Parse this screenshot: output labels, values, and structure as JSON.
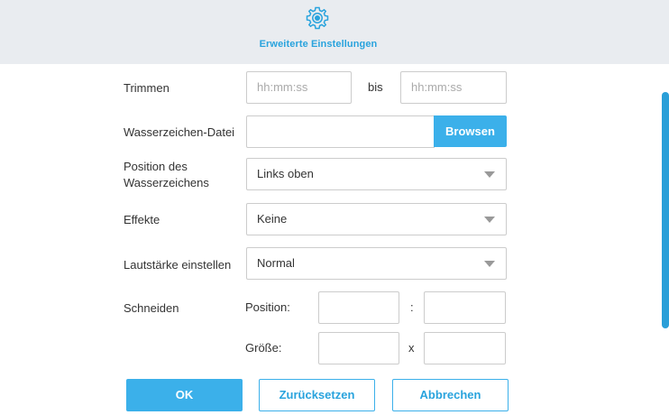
{
  "header": {
    "tab_label": "Erweiterte Einstellungen",
    "tab_icon": "gear-icon",
    "accent": "#29a3dd"
  },
  "form": {
    "trim": {
      "label": "Trimmen",
      "from_placeholder": "hh:mm:ss",
      "separator": "bis",
      "to_placeholder": "hh:mm:ss"
    },
    "watermark_file": {
      "label": "Wasserzeichen-Datei",
      "value": "",
      "browse_label": "Browsen"
    },
    "watermark_position": {
      "label_line1": "Position des",
      "label_line2": "Wasserzeichens",
      "selected": "Links oben"
    },
    "effects": {
      "label": "Effekte",
      "selected": "Keine"
    },
    "volume": {
      "label": "Lautstärke einstellen",
      "selected": "Normal"
    },
    "crop": {
      "label": "Schneiden",
      "position_label": "Position:",
      "position_sep": ":",
      "size_label": "Größe:",
      "size_sep": "x"
    }
  },
  "buttons": {
    "ok": "OK",
    "reset": "Zurücksetzen",
    "cancel": "Abbrechen"
  },
  "colors": {
    "primary_button": "#3bb0ea",
    "topbar_bg": "#e9ecf0",
    "scrollbar": "#2a9fd8"
  }
}
